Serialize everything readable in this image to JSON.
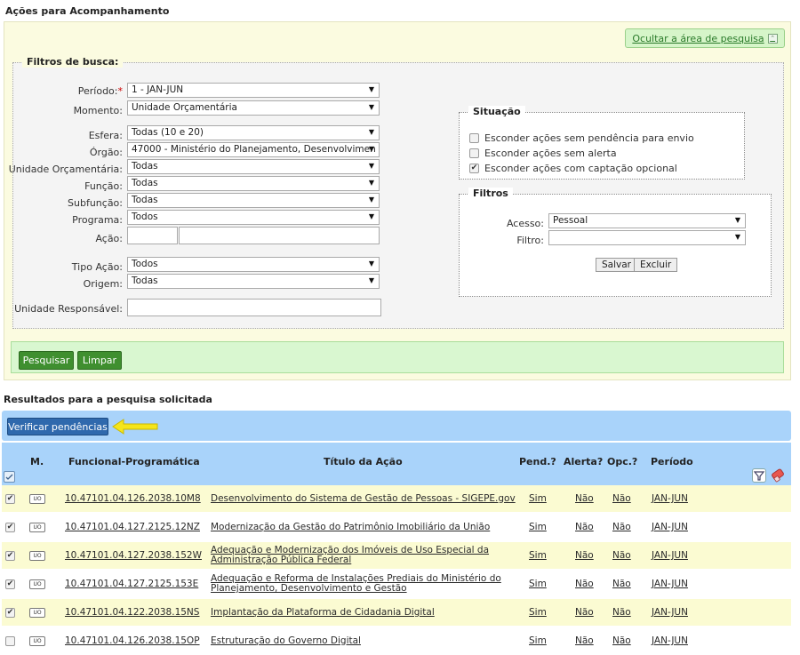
{
  "page_title": "Ações para Acompanhamento",
  "hide_search_label": "Ocultar a área de pesquisa",
  "filters": {
    "legend": "Filtros de busca:",
    "periodo": {
      "label": "Período:",
      "required_mark": "*",
      "value": "1 - JAN-JUN"
    },
    "momento": {
      "label": "Momento:",
      "value": "Unidade Orçamentária"
    },
    "esfera": {
      "label": "Esfera:",
      "value": "Todas (10 e 20)"
    },
    "orgao": {
      "label": "Órgão:",
      "value": "47000 - Ministério do Planejamento, Desenvolvimen"
    },
    "unidade_orcamentaria": {
      "label": "Unidade Orçamentária:",
      "value": "Todas"
    },
    "funcao": {
      "label": "Função:",
      "value": "Todas"
    },
    "subfuncao": {
      "label": "Subfunção:",
      "value": "Todas"
    },
    "programa": {
      "label": "Programa:",
      "value": "Todos"
    },
    "acao": {
      "label": "Ação:",
      "value_code": "",
      "value_desc": ""
    },
    "tipo_acao": {
      "label": "Tipo Ação:",
      "value": "Todos"
    },
    "origem": {
      "label": "Origem:",
      "value": "Todas"
    },
    "unidade_responsavel": {
      "label": "Unidade Responsável:",
      "value": ""
    }
  },
  "situacao": {
    "legend": "Situação",
    "options": [
      {
        "label": "Esconder ações sem pendência para envio",
        "checked": false
      },
      {
        "label": "Esconder ações sem alerta",
        "checked": false
      },
      {
        "label": "Esconder ações com captação opcional",
        "checked": true
      }
    ]
  },
  "filtros_box": {
    "legend": "Filtros",
    "acesso": {
      "label": "Acesso:",
      "value": "Pessoal"
    },
    "filtro": {
      "label": "Filtro:",
      "value": ""
    },
    "salvar": "Salvar",
    "excluir": "Excluir"
  },
  "buttons": {
    "pesquisar": "Pesquisar",
    "limpar": "Limpar"
  },
  "results_title": "Resultados para a pesquisa solicitada",
  "verify_button": "Verificar pendências",
  "table": {
    "headers": {
      "m": "M.",
      "funcional": "Funcional-Programática",
      "titulo": "Título da Ação",
      "pend": "Pend.?",
      "alerta": "Alerta?",
      "opc": "Opc.?",
      "periodo": "Período"
    },
    "badge": "UO",
    "rows": [
      {
        "checked": true,
        "code": "10.47101.04.126.2038.10M8",
        "title1": "Desenvolvimento do Sistema de Gestão de Pessoas - SIGEPE.gov",
        "title2": "",
        "pend": "Sim",
        "alerta": "Não",
        "opc": "Não",
        "periodo": "JAN-JUN"
      },
      {
        "checked": true,
        "code": "10.47101.04.127.2125.12NZ",
        "title1": "Modernização da Gestão do Patrimônio Imobiliário da União",
        "title2": "",
        "pend": "Sim",
        "alerta": "Não",
        "opc": "Não",
        "periodo": "JAN-JUN"
      },
      {
        "checked": true,
        "code": "10.47101.04.127.2038.152W",
        "title1": "Adequação e Modernização dos Imóveis de Uso Especial da",
        "title2": "Administração Pública Federal",
        "pend": "Sim",
        "alerta": "Não",
        "opc": "Não",
        "periodo": "JAN-JUN"
      },
      {
        "checked": true,
        "code": "10.47101.04.127.2125.153E",
        "title1": "Adequação e Reforma de Instalações Prediais do Ministério do",
        "title2": "Planejamento, Desenvolvimento e Gestão",
        "pend": "Sim",
        "alerta": "Não",
        "opc": "Não",
        "periodo": "JAN-JUN"
      },
      {
        "checked": true,
        "code": "10.47101.04.122.2038.15NS",
        "title1": "Implantação da Plataforma de Cidadania Digital",
        "title2": "",
        "pend": "Sim",
        "alerta": "Não",
        "opc": "Não",
        "periodo": "JAN-JUN"
      },
      {
        "checked": false,
        "code": "10.47101.04.126.2038.15OP",
        "title1": "Estruturação do Governo Digital",
        "title2": "",
        "pend": "Sim",
        "alerta": "Não",
        "opc": "Não",
        "periodo": "JAN-JUN"
      }
    ]
  },
  "colors": {
    "highlight_row": "#fbfbd2",
    "header_blue": "#a9d3fa",
    "button_green": "#3f8f2f",
    "button_blue": "#2f69ad",
    "arrow_yellow": "#f5e51b"
  }
}
